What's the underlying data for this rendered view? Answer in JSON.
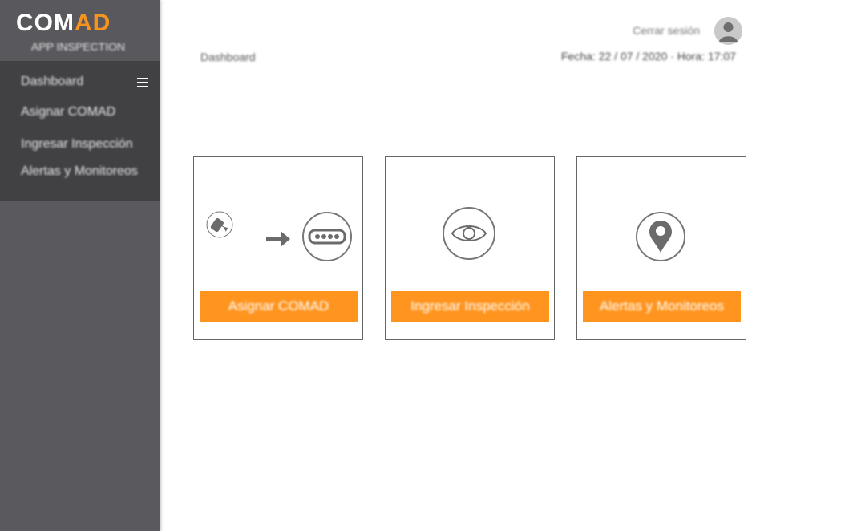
{
  "brand": {
    "logo_part1": "COM",
    "logo_part2": "AD",
    "subtitle": "APP INSPECTION",
    "accent_color": "#f7941d"
  },
  "sidebar": {
    "menu_icon": "hamburger-menu-icon",
    "items": [
      {
        "label": "Dashboard"
      },
      {
        "label": "Asignar COMAD"
      },
      {
        "label": "Ingresar Inspección"
      },
      {
        "label": "Alertas y Monitoreos"
      }
    ]
  },
  "header": {
    "breadcrumb": "Dashboard",
    "logout_label": "Cerrar sesión",
    "avatar_icon": "user-avatar-icon",
    "datetime": "Fecha: 22 / 07 / 2020 · Hora: 17:07"
  },
  "cards": [
    {
      "button_label": "Asignar COMAD",
      "icons": [
        "device-icon",
        "arrow-right-icon",
        "device-slot-icon"
      ]
    },
    {
      "button_label": "Ingresar Inspección",
      "icons": [
        "eye-icon"
      ]
    },
    {
      "button_label": "Alertas y Monitoreos",
      "icons": [
        "location-pin-icon"
      ]
    }
  ],
  "colors": {
    "sidebar": "#5a595e",
    "menu": "#414043",
    "button": "#ff951f"
  }
}
